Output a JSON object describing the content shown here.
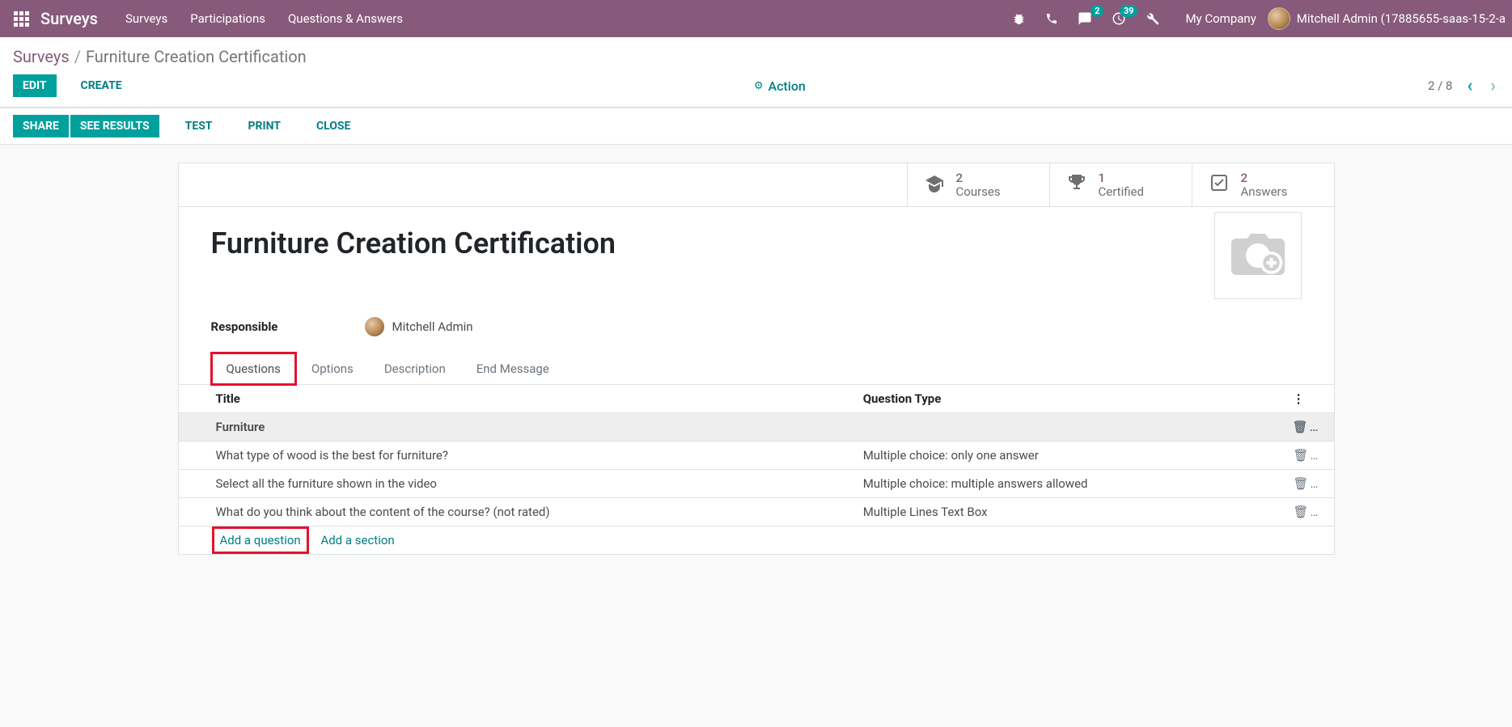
{
  "topbar": {
    "brand": "Surveys",
    "nav": [
      "Surveys",
      "Participations",
      "Questions & Answers"
    ],
    "msg_badge": "2",
    "activity_badge": "39",
    "company": "My Company",
    "user": "Mitchell Admin (17885655-saas-15-2-a"
  },
  "breadcrumb": {
    "root": "Surveys",
    "current": "Furniture Creation Certification"
  },
  "controls": {
    "edit": "EDIT",
    "create": "CREATE",
    "action": "Action",
    "pager": "2 / 8"
  },
  "secondary": {
    "share": "SHARE",
    "see_results": "SEE RESULTS",
    "test": "TEST",
    "print": "PRINT",
    "close": "CLOSE"
  },
  "stats": {
    "courses": {
      "num": "2",
      "label": "Courses"
    },
    "certified": {
      "num": "1",
      "label": "Certified"
    },
    "answers": {
      "num": "2",
      "label": "Answers"
    }
  },
  "form": {
    "title": "Furniture Creation Certification",
    "responsible_label": "Responsible",
    "responsible_value": "Mitchell Admin"
  },
  "tabs": [
    "Questions",
    "Options",
    "Description",
    "End Message"
  ],
  "table": {
    "col_title": "Title",
    "col_type": "Question Type",
    "section": "Furniture",
    "rows": [
      {
        "title": "What type of wood is the best for furniture?",
        "type": "Multiple choice: only one answer"
      },
      {
        "title": "Select all the furniture shown in the video",
        "type": "Multiple choice: multiple answers allowed"
      },
      {
        "title": "What do you think about the content of the course? (not rated)",
        "type": "Multiple Lines Text Box"
      }
    ],
    "add_question": "Add a question",
    "add_section": "Add a section"
  }
}
